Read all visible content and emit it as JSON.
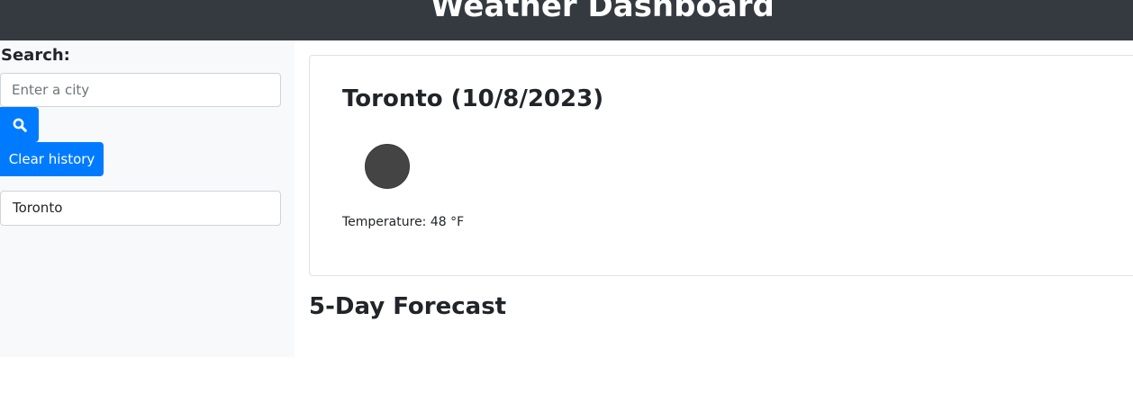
{
  "header": {
    "title": "Weather Dashboard"
  },
  "sidebar": {
    "search_label": "Search:",
    "search_placeholder": "Enter a city",
    "search_value": "",
    "search_button_icon": "search-icon",
    "clear_history_label": "Clear history",
    "history": [
      "Toronto"
    ]
  },
  "current": {
    "title": "Toronto (10/8/2023)",
    "weather_icon": "weather-icon",
    "temperature_label": "Temperature:",
    "temperature_value": "48",
    "temperature_unit": "°F"
  },
  "forecast": {
    "title": "5-Day Forecast"
  },
  "colors": {
    "header_bg": "#343a40",
    "accent": "#007bff",
    "sidebar_bg": "#f8f9fa"
  }
}
